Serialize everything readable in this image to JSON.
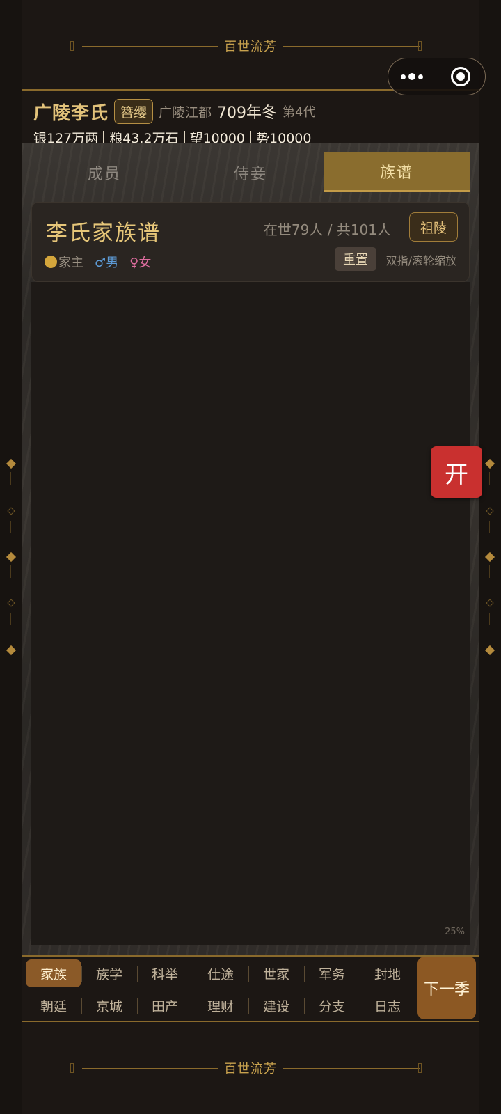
{
  "app": {
    "banner_top": "百世流芳",
    "banner_bottom": "百世流芳"
  },
  "capsule": {
    "more_icon": "more-dots-icon",
    "close_icon": "target-icon"
  },
  "header": {
    "clan_name": "广陵李氏",
    "rank": "簪缨",
    "place": "广陵江都",
    "date": "709年冬",
    "generation": "第4代",
    "resources": [
      "银127万两",
      "粮43.2万石",
      "望10000",
      "势10000"
    ]
  },
  "tabs": [
    {
      "label": "成员",
      "active": false
    },
    {
      "label": "侍妾",
      "active": false
    },
    {
      "label": "族谱",
      "active": true
    }
  ],
  "genealogy": {
    "title": "李氏家族谱",
    "count": "在世79人 / 共101人",
    "tomb_button": "祖陵",
    "legend_head": "家主",
    "legend_male": "♂男",
    "legend_female": "♀女",
    "reset_button": "重置",
    "hint": "双指/滚轮缩放",
    "zoom": "25%"
  },
  "float_button": "开",
  "nav": {
    "row1": [
      "家族",
      "族学",
      "科举",
      "仕途",
      "世家",
      "军务",
      "封地"
    ],
    "row2": [
      "朝廷",
      "京城",
      "田产",
      "理财",
      "建设",
      "分支",
      "日志"
    ],
    "active": "家族",
    "next": "下一季"
  },
  "colors": {
    "gold": "#c8a24e",
    "active_tab": "#8a6d2e",
    "open_button": "#c9302f",
    "next_button": "#8c5823"
  }
}
